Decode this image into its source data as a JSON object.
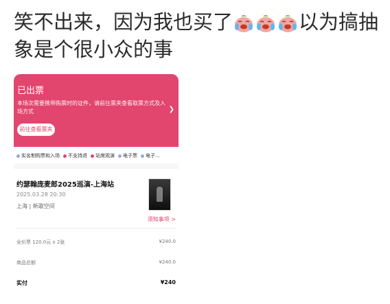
{
  "caption": {
    "text_before": "笑不出来，因为我也买了",
    "emoji_count": 3,
    "emoji_name": "crying-laughing-emoji",
    "text_after": "以为搞抽象是个很小众的事"
  },
  "ticket": {
    "status": "已出票",
    "notice": "本场次需要携带购票时的证件，请前往票夹查看取票方式及入场方式",
    "wallet_button": "前往查看票夹",
    "accent": "#e2456e"
  },
  "tags": [
    {
      "label": "实名制购票和入场",
      "color": "#9aa7d6"
    },
    {
      "label": "不支持退",
      "color": "#e2456e"
    },
    {
      "label": "站席观演",
      "color": "#e2456e"
    },
    {
      "label": "电子票",
      "color": "#9aa7d6"
    },
    {
      "label": "电子...",
      "color": "#9aa7d6"
    }
  ],
  "event": {
    "title": "约瑟翰庞麦郎2025巡演-上海站",
    "datetime": "2025.03.28 20:30",
    "venue": "上海 | 新歌空间",
    "notes_link": "须知事项 >"
  },
  "price": {
    "rows": [
      {
        "label": "全价票 120.0元 x 2张",
        "value": "¥240.0"
      },
      {
        "label": "商品总额",
        "value": "¥240.0"
      },
      {
        "label": "实付",
        "value": "¥240"
      }
    ]
  }
}
